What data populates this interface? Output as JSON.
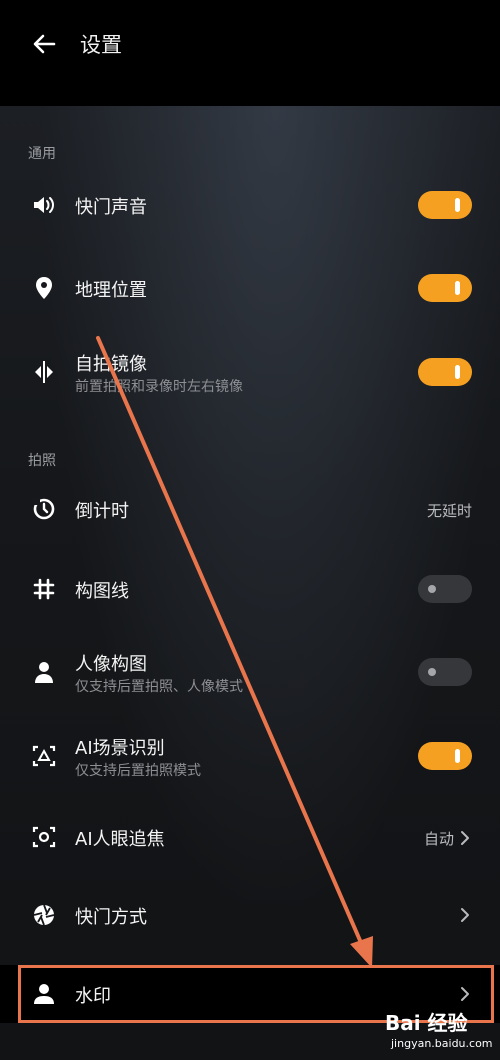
{
  "header": {
    "title": "设置"
  },
  "sections": [
    {
      "label": "通用"
    },
    {
      "label": "拍照"
    }
  ],
  "rows": [
    {
      "icon": "speaker-icon",
      "label": "快门声音",
      "toggle": "on"
    },
    {
      "icon": "location-pin-icon",
      "label": "地理位置",
      "toggle": "on"
    },
    {
      "icon": "mirror-icon",
      "label": "自拍镜像",
      "sub": "前置拍照和录像时左右镜像",
      "toggle": "on"
    },
    {
      "icon": "timer-icon",
      "label": "倒计时",
      "value": "无延时"
    },
    {
      "icon": "grid-hash-icon",
      "label": "构图线",
      "toggle": "off"
    },
    {
      "icon": "person-icon",
      "label": "人像构图",
      "sub": "仅支持后置拍照、人像模式",
      "toggle": "off"
    },
    {
      "icon": "ai-scene-icon",
      "label": "AI场景识别",
      "sub": "仅支持后置拍照模式",
      "toggle": "on"
    },
    {
      "icon": "eye-focus-icon",
      "label": "AI人眼追焦",
      "value": "自动"
    },
    {
      "icon": "aperture-icon",
      "label": "快门方式"
    },
    {
      "icon": "watermark-person-icon",
      "label": "水印"
    }
  ],
  "watermark": {
    "logo": "Bai  经验",
    "url": "jingyan.baidu.com"
  },
  "colors": {
    "accent": "#f5a021",
    "annotation": "#e8754b"
  }
}
